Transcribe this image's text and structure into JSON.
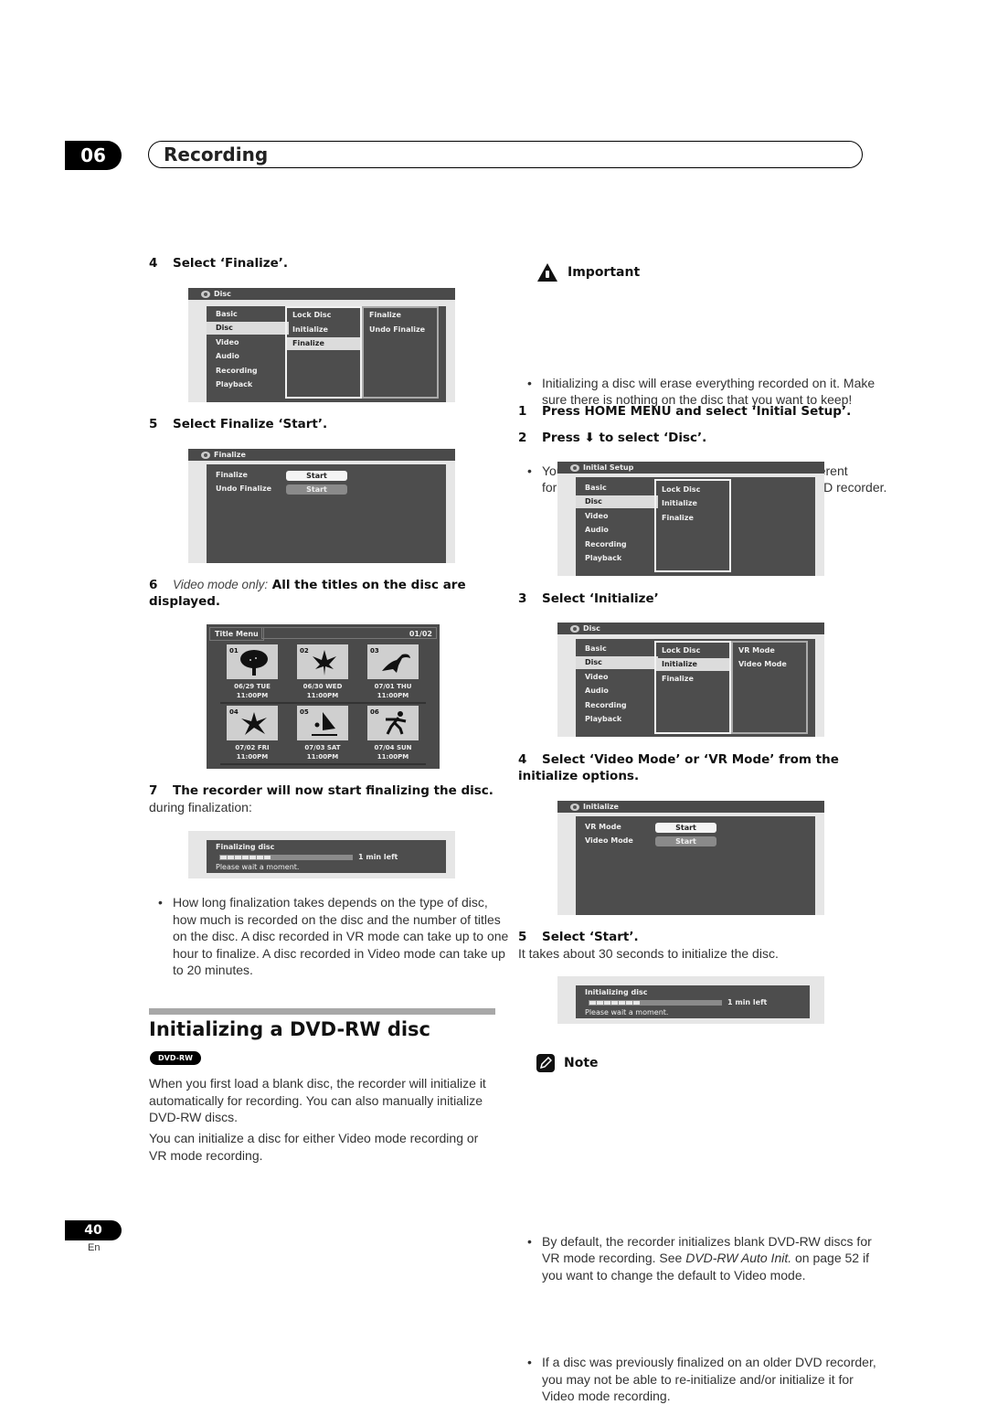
{
  "header": {
    "chapter_number": "06",
    "chapter_title": "Recording"
  },
  "left": {
    "step4": {
      "num": "4",
      "text": "Select ‘Finalize’."
    },
    "osd_disc_finalize": {
      "title": "Disc",
      "menu": [
        "Basic",
        "Disc",
        "Video",
        "Audio",
        "Recording",
        "Playback"
      ],
      "selected_menu": "Disc",
      "col2": [
        "Lock Disc",
        "Initialize",
        "Finalize"
      ],
      "selected_col2": "Finalize",
      "col3": [
        "Finalize",
        "Undo Finalize"
      ]
    },
    "step5": {
      "num": "5",
      "text": "Select Finalize ‘Start’."
    },
    "osd_finalize": {
      "title": "Finalize",
      "rows": [
        {
          "label": "Finalize",
          "button": "Start",
          "state": "selected"
        },
        {
          "label": "Undo Finalize",
          "button": "Start",
          "state": "unselected"
        }
      ]
    },
    "step6": {
      "num": "6",
      "prefix": "Video mode only:",
      "text": "All the titles on the disc are displayed."
    },
    "title_menu": {
      "label": "Title Menu",
      "page": "01/02",
      "titles": [
        {
          "num": "01",
          "icon": "tree-icon",
          "date": "06/29 TUE",
          "time": "11:00PM"
        },
        {
          "num": "02",
          "icon": "leaf-icon",
          "date": "06/30 WED",
          "time": "11:00PM"
        },
        {
          "num": "03",
          "icon": "toucan-icon",
          "date": "07/01 THU",
          "time": "11:00PM"
        },
        {
          "num": "04",
          "icon": "lily-icon",
          "date": "07/02 FRI",
          "time": "11:00PM"
        },
        {
          "num": "05",
          "icon": "windsurfer-icon",
          "date": "07/03 SAT",
          "time": "11:00PM"
        },
        {
          "num": "06",
          "icon": "skater-icon",
          "date": "07/04 SUN",
          "time": "11:00PM"
        }
      ]
    },
    "step7": {
      "num": "7",
      "text": "The recorder will now start finalizing the disc.",
      "sub": "during finalization:"
    },
    "finalizing_progress": {
      "title": "Finalizing disc",
      "remaining": "1 min left",
      "message": "Please wait a moment.",
      "progress_fraction": 0.5
    },
    "bullets": [
      "How long finalization takes depends on the type of disc, how much is recorded on the disc and the number of titles on the disc. A disc recorded in VR mode can take up to one hour to finalize. A disc recorded in Video mode can take up to 20 minutes."
    ],
    "section": {
      "title": "Initializing a DVD-RW disc",
      "badge": "DVD-RW",
      "paragraphs": [
        "When you first load a blank disc, the recorder will initialize it automatically for recording. You can also manually initialize DVD-RW discs.",
        "You can initialize a disc for either Video mode recording or VR mode recording."
      ]
    }
  },
  "right": {
    "important": {
      "heading": "Important",
      "bullets": [
        "Initializing a disc will erase everything recorded on it. Make sure there is nothing on the disc that you want to keep!",
        "You may not be able to re-initialize a disc in a different format if it was originally initialized on an older DVD recorder."
      ]
    },
    "step1": {
      "num": "1",
      "text": "Press HOME MENU and select ‘Initial Setup’."
    },
    "step2": {
      "num": "2",
      "before": "Press",
      "arrow": "⬇",
      "after": "to select ‘Disc’."
    },
    "osd_initial_setup": {
      "title": "Initial Setup",
      "menu": [
        "Basic",
        "Disc",
        "Video",
        "Audio",
        "Recording",
        "Playback"
      ],
      "selected_menu": "Disc",
      "col2": [
        "Lock Disc",
        "Initialize",
        "Finalize"
      ]
    },
    "step3": {
      "num": "3",
      "text": "Select ‘Initialize’"
    },
    "osd_disc_initialize": {
      "title": "Disc",
      "menu": [
        "Basic",
        "Disc",
        "Video",
        "Audio",
        "Recording",
        "Playback"
      ],
      "selected_menu": "Disc",
      "col2": [
        "Lock Disc",
        "Initialize",
        "Finalize"
      ],
      "selected_col2": "Initialize",
      "col3": [
        "VR Mode",
        "Video Mode"
      ]
    },
    "step4": {
      "num": "4",
      "text": "Select ‘Video Mode’ or ‘VR Mode’ from the initialize options."
    },
    "osd_initialize": {
      "title": "Initialize",
      "rows": [
        {
          "label": "VR Mode",
          "button": "Start",
          "state": "selected"
        },
        {
          "label": "Video Mode",
          "button": "Start",
          "state": "unselected"
        }
      ]
    },
    "step5": {
      "num": "5",
      "text": "Select ‘Start’.",
      "sub": "It takes about 30 seconds to initialize the disc."
    },
    "initializing_progress": {
      "title": "Initializing disc",
      "remaining": "1 min left",
      "message": "Please wait a moment.",
      "progress_fraction": 0.5
    },
    "note": {
      "heading": "Note",
      "bullet1_pre": "By default, the recorder initializes blank DVD-RW discs for VR mode recording. See ",
      "bullet1_ref": "DVD-RW Auto Init.",
      "bullet1_post": " on page 52 if you want to change the default to Video mode.",
      "bullet2": "If a disc was previously finalized on an older DVD recorder, you may not be able to re-initialize and/or initialize it for Video mode recording."
    }
  },
  "footer": {
    "page_number": "40",
    "language": "En"
  }
}
